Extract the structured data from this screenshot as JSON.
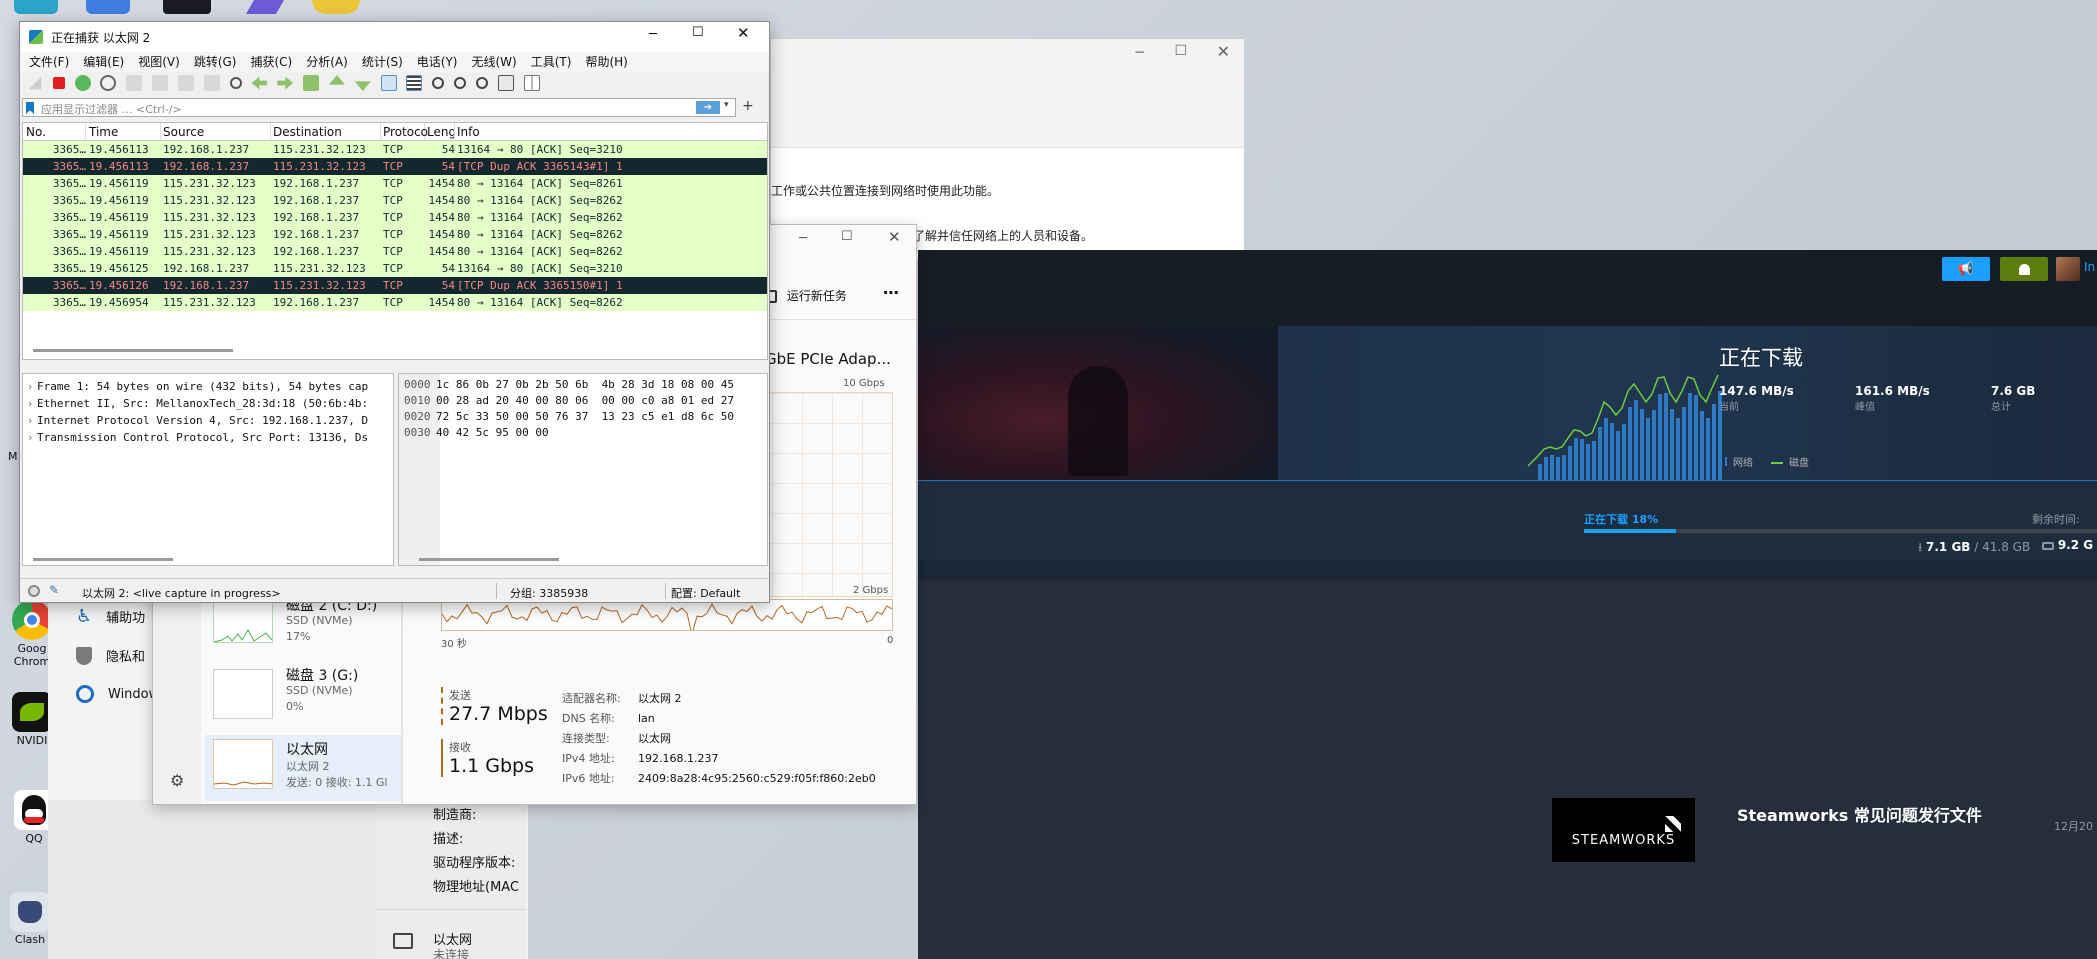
{
  "desktop": {
    "icons": [
      {
        "label": "Google Chrome",
        "short": "Goog Chrom",
        "color": "#4285f4"
      },
      {
        "label": "NVIDIA",
        "short": "NVIDI",
        "color": "#76b900"
      },
      {
        "label": "QQ",
        "short": "QQ",
        "color": "#f5f5f5"
      },
      {
        "label": "Clash",
        "short": "Clash",
        "color": "#3a4a78"
      }
    ],
    "edge_label": "M"
  },
  "settings": {
    "text1": "工作或公共位置连接到网络时使用此功能。",
    "text2": "选项。你应该了解并信任网络上的人员和设备。",
    "nav": [
      {
        "label": "辅助功",
        "icon": "accessibility-icon"
      },
      {
        "label": "隐私和",
        "icon": "shield-icon"
      },
      {
        "label": "Window",
        "icon": "update-icon"
      }
    ]
  },
  "driver": {
    "labels": [
      "制造商:",
      "描述:",
      "驱动程序版本:",
      "物理地址(MAC"
    ],
    "adapter_name": "以太网",
    "adapter_status": "未连接"
  },
  "steam": {
    "status_title": "正在下载",
    "stats": [
      {
        "value": "147.6 MB/s",
        "label": "当前"
      },
      {
        "value": "161.6 MB/s",
        "label": "峰值"
      },
      {
        "value": "7.6 GB",
        "label": "总计"
      }
    ],
    "legend": [
      {
        "label": "网络"
      },
      {
        "label": "磁盘"
      }
    ],
    "progress_label": "正在下载 18%",
    "progress": 0.18,
    "remaining_label": "剩余时间:",
    "downloaded": "7.1 GB",
    "total": "/ 41.8 GB",
    "disk": "9.2 G",
    "user_initial": "In",
    "news_title": "Steamworks 常见问题发行文件",
    "news_date": "12月20",
    "steamworks_logo": "STEAMWORKS"
  },
  "taskmgr": {
    "run_task": "运行新任务",
    "adapter_title": "GbE PCIe Adap...",
    "graph_top": "10 Gbps",
    "graph_low": "2 Gbps",
    "axis_left": "30 秒",
    "axis_right": "0",
    "devices": [
      {
        "name": "磁盘 2 (C: D:)",
        "type": "SSD (NVMe)",
        "value": "17%"
      },
      {
        "name": "磁盘 3 (G:)",
        "type": "SSD (NVMe)",
        "value": "0%"
      },
      {
        "name": "以太网",
        "type": "以太网 2",
        "value": "发送: 0 接收: 1.1 Gl"
      }
    ],
    "send_label": "发送",
    "send_value": "27.7 Mbps",
    "recv_label": "接收",
    "recv_value": "1.1 Gbps",
    "props": [
      {
        "k": "适配器名称:",
        "v": "以太网 2"
      },
      {
        "k": "DNS 名称:",
        "v": "lan"
      },
      {
        "k": "连接类型:",
        "v": "以太网"
      },
      {
        "k": "IPv4 地址:",
        "v": "192.168.1.237"
      },
      {
        "k": "IPv6 地址:",
        "v": "2409:8a28:4c95:2560:c529:f05f:f860:2eb0"
      }
    ]
  },
  "wireshark": {
    "title": "正在捕获 以太网 2",
    "menu": [
      "文件(F)",
      "编辑(E)",
      "视图(V)",
      "跳转(G)",
      "捕获(C)",
      "分析(A)",
      "统计(S)",
      "电话(Y)",
      "无线(W)",
      "工具(T)",
      "帮助(H)"
    ],
    "filter_placeholder": "应用显示过滤器 … <Ctrl-/>",
    "columns": [
      "No.",
      "Time",
      "Source",
      "Destination",
      "Protoco",
      "Lengt",
      "Info"
    ],
    "packets": [
      {
        "no": "3365…",
        "time": "19.456113",
        "src": "192.168.1.237",
        "dst": "115.231.32.123",
        "proto": "TCP",
        "len": "54",
        "info": "13164 → 80 [ACK] Seq=3210",
        "bad": false
      },
      {
        "no": "3365…",
        "time": "19.456113",
        "src": "192.168.1.237",
        "dst": "115.231.32.123",
        "proto": "TCP",
        "len": "54",
        "info": "[TCP Dup ACK 3365143#1] 1",
        "bad": true
      },
      {
        "no": "3365…",
        "time": "19.456119",
        "src": "115.231.32.123",
        "dst": "192.168.1.237",
        "proto": "TCP",
        "len": "1454",
        "info": "80 → 13164 [ACK] Seq=8261",
        "bad": false
      },
      {
        "no": "3365…",
        "time": "19.456119",
        "src": "115.231.32.123",
        "dst": "192.168.1.237",
        "proto": "TCP",
        "len": "1454",
        "info": "80 → 13164 [ACK] Seq=8262",
        "bad": false
      },
      {
        "no": "3365…",
        "time": "19.456119",
        "src": "115.231.32.123",
        "dst": "192.168.1.237",
        "proto": "TCP",
        "len": "1454",
        "info": "80 → 13164 [ACK] Seq=8262",
        "bad": false
      },
      {
        "no": "3365…",
        "time": "19.456119",
        "src": "115.231.32.123",
        "dst": "192.168.1.237",
        "proto": "TCP",
        "len": "1454",
        "info": "80 → 13164 [ACK] Seq=8262",
        "bad": false
      },
      {
        "no": "3365…",
        "time": "19.456119",
        "src": "115.231.32.123",
        "dst": "192.168.1.237",
        "proto": "TCP",
        "len": "1454",
        "info": "80 → 13164 [ACK] Seq=8262",
        "bad": false
      },
      {
        "no": "3365…",
        "time": "19.456125",
        "src": "192.168.1.237",
        "dst": "115.231.32.123",
        "proto": "TCP",
        "len": "54",
        "info": "13164 → 80 [ACK] Seq=3210",
        "bad": false
      },
      {
        "no": "3365…",
        "time": "19.456126",
        "src": "192.168.1.237",
        "dst": "115.231.32.123",
        "proto": "TCP",
        "len": "54",
        "info": "[TCP Dup ACK 3365150#1] 1",
        "bad": true
      },
      {
        "no": "3365…",
        "time": "19.456954",
        "src": "115.231.32.123",
        "dst": "192.168.1.237",
        "proto": "TCP",
        "len": "1454",
        "info": "80 → 13164 [ACK] Seq=8262",
        "bad": false
      }
    ],
    "details": [
      "Frame 1: 54 bytes on wire (432 bits), 54 bytes cap",
      "Ethernet II, Src: MellanoxTech_28:3d:18 (50:6b:4b:",
      "Internet Protocol Version 4, Src: 192.168.1.237, D",
      "Transmission Control Protocol, Src Port: 13136, Ds"
    ],
    "hex": [
      {
        "off": "0000",
        "bytes": "1c 86 0b 27 0b 2b 50 6b  4b 28 3d 18 08 00 45"
      },
      {
        "off": "0010",
        "bytes": "00 28 ad 20 40 00 80 06  00 00 c0 a8 01 ed 27"
      },
      {
        "off": "0020",
        "bytes": "72 5c 33 50 00 50 76 37  13 23 c5 e1 d8 6c 50"
      },
      {
        "off": "0030",
        "bytes": "40 42 5c 95 00 00"
      }
    ],
    "status_capture": "以太网 2: <live capture in progress>",
    "status_packets": "分组: 3385938",
    "status_profile": "配置: Default"
  }
}
